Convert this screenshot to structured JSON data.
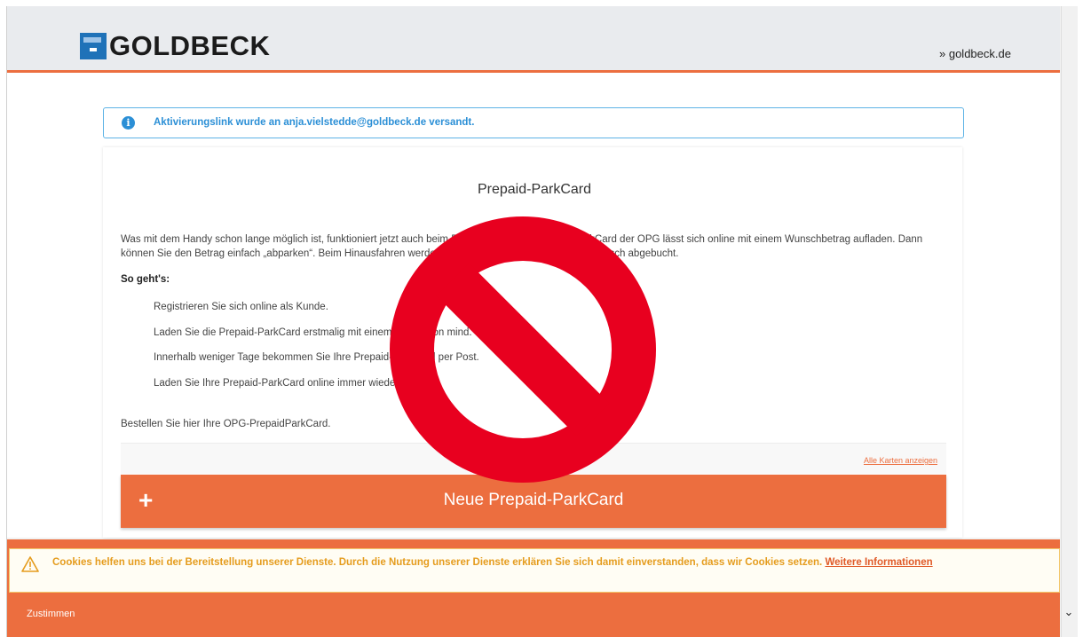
{
  "header": {
    "brand": "GOLDBECK",
    "site_link": "» goldbeck.de"
  },
  "alert": {
    "icon": "info-icon",
    "message": "Aktivierungslink wurde an anja.vielstedde@goldbeck.de versandt."
  },
  "card": {
    "title": "Prepaid-ParkCard",
    "description": "Was mit dem Handy schon lange möglich ist, funktioniert jetzt auch beim Parken: Die blaue Prepaid-ParkCard der OPG lässt sich online mit einem Wunschbetrag aufladen. Dann können Sie den Betrag einfach „abparken“. Beim Hinausfahren werden die angefallenen Gebühren automatisch abgebucht.",
    "howto_heading": "So geht's:",
    "steps": [
      "Registrieren Sie sich online als Kunde.",
      "Laden Sie die Prepaid-ParkCard erstmalig mit einem Betrag von mind.",
      "Innerhalb weniger Tage bekommen Sie Ihre Prepaid-ParkCard per Post.",
      "Laden Sie Ihre Prepaid-ParkCard online immer wieder neu auf."
    ],
    "order_text": "Bestellen Sie hier Ihre OPG-PrepaidParkCard.",
    "all_cards_link": "Alle Karten anzeigen",
    "new_card_button": "Neue Prepaid-ParkCard",
    "plus_symbol": "+"
  },
  "cookie": {
    "message": "Cookies helfen uns bei der Bereitstellung unserer Dienste. Durch die Nutzung unserer Dienste erklären Sie sich damit einverstanden, dass wir Cookies setzen.",
    "more_link": "Weitere Informationen",
    "agree_button": "Zustimmen"
  },
  "overlay": {
    "icon": "prohibited-icon",
    "color": "#e8001f"
  },
  "colors": {
    "accent": "#ec6e3f",
    "info": "#2b8fd6",
    "warning": "#e59c1d"
  }
}
